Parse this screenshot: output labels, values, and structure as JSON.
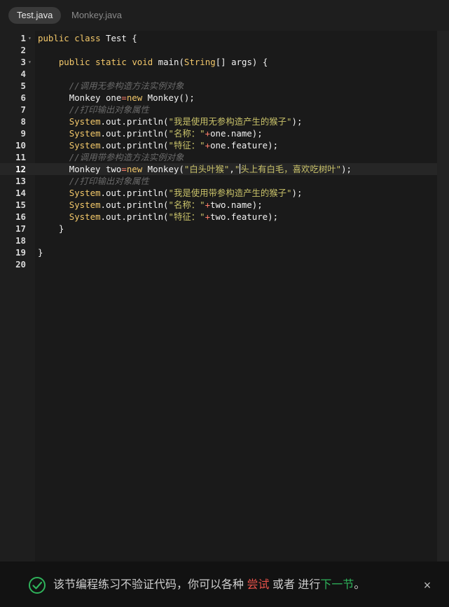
{
  "tabs": [
    {
      "label": "Test.java",
      "active": true
    },
    {
      "label": "Monkey.java",
      "active": false
    }
  ],
  "editor": {
    "current_line": 12,
    "lines": [
      {
        "n": "1",
        "fold": true,
        "tokens": [
          [
            "kw",
            "public"
          ],
          [
            "plain",
            " "
          ],
          [
            "kw",
            "class"
          ],
          [
            "plain",
            " Test {"
          ]
        ]
      },
      {
        "n": "2",
        "tokens": []
      },
      {
        "n": "3",
        "fold": true,
        "tokens": [
          [
            "plain",
            "    "
          ],
          [
            "kw",
            "public"
          ],
          [
            "plain",
            " "
          ],
          [
            "kw",
            "static"
          ],
          [
            "plain",
            " "
          ],
          [
            "kw",
            "void"
          ],
          [
            "plain",
            " main("
          ],
          [
            "cls",
            "String"
          ],
          [
            "plain",
            "[] args) {"
          ]
        ]
      },
      {
        "n": "4",
        "tokens": []
      },
      {
        "n": "5",
        "tokens": [
          [
            "plain",
            "      "
          ],
          [
            "cmt",
            "//调用无参构造方法实例对象"
          ]
        ]
      },
      {
        "n": "6",
        "tokens": [
          [
            "plain",
            "      Monkey one"
          ],
          [
            "op",
            "="
          ],
          [
            "kw",
            "new"
          ],
          [
            "plain",
            " Monkey();"
          ]
        ]
      },
      {
        "n": "7",
        "tokens": [
          [
            "plain",
            "      "
          ],
          [
            "cmt",
            "//打印输出对象属性"
          ]
        ]
      },
      {
        "n": "8",
        "tokens": [
          [
            "plain",
            "      "
          ],
          [
            "cls",
            "System"
          ],
          [
            "plain",
            ".out.println("
          ],
          [
            "str",
            "\"我是使用无参构造产生的猴子\""
          ],
          [
            "plain",
            ");"
          ]
        ]
      },
      {
        "n": "9",
        "tokens": [
          [
            "plain",
            "      "
          ],
          [
            "cls",
            "System"
          ],
          [
            "plain",
            ".out.println("
          ],
          [
            "str",
            "\"名称：\""
          ],
          [
            "op",
            "+"
          ],
          [
            "plain",
            "one.name);"
          ]
        ]
      },
      {
        "n": "10",
        "tokens": [
          [
            "plain",
            "      "
          ],
          [
            "cls",
            "System"
          ],
          [
            "plain",
            ".out.println("
          ],
          [
            "str",
            "\"特征：\""
          ],
          [
            "op",
            "+"
          ],
          [
            "plain",
            "one.feature);"
          ]
        ]
      },
      {
        "n": "11",
        "tokens": [
          [
            "plain",
            "      "
          ],
          [
            "cmt",
            "//调用带参构造方法实例对象"
          ]
        ]
      },
      {
        "n": "12",
        "tokens": [
          [
            "plain",
            "      Monkey two"
          ],
          [
            "op",
            "="
          ],
          [
            "kw",
            "new"
          ],
          [
            "plain",
            " Monkey("
          ],
          [
            "str",
            "\"白头叶猴\""
          ],
          [
            "plain",
            ","
          ],
          [
            "str",
            "\""
          ],
          [
            "cursor",
            ""
          ],
          [
            "str",
            "头上有白毛，喜欢吃树叶\""
          ],
          [
            "plain",
            ");"
          ]
        ]
      },
      {
        "n": "13",
        "tokens": [
          [
            "plain",
            "      "
          ],
          [
            "cmt",
            "//打印输出对象属性"
          ]
        ]
      },
      {
        "n": "14",
        "tokens": [
          [
            "plain",
            "      "
          ],
          [
            "cls",
            "System"
          ],
          [
            "plain",
            ".out.println("
          ],
          [
            "str",
            "\"我是使用带参构造产生的猴子\""
          ],
          [
            "plain",
            ");"
          ]
        ]
      },
      {
        "n": "15",
        "tokens": [
          [
            "plain",
            "      "
          ],
          [
            "cls",
            "System"
          ],
          [
            "plain",
            ".out.println("
          ],
          [
            "str",
            "\"名称：\""
          ],
          [
            "op",
            "+"
          ],
          [
            "plain",
            "two.name);"
          ]
        ]
      },
      {
        "n": "16",
        "tokens": [
          [
            "plain",
            "      "
          ],
          [
            "cls",
            "System"
          ],
          [
            "plain",
            ".out.println("
          ],
          [
            "str",
            "\"特征：\""
          ],
          [
            "op",
            "+"
          ],
          [
            "plain",
            "two.feature);"
          ]
        ]
      },
      {
        "n": "17",
        "tokens": [
          [
            "plain",
            "    }"
          ]
        ]
      },
      {
        "n": "18",
        "tokens": []
      },
      {
        "n": "19",
        "tokens": [
          [
            "plain",
            "}"
          ]
        ]
      },
      {
        "n": "20",
        "tokens": []
      }
    ]
  },
  "notice": {
    "text_before": "该节编程练习不验证代码，你可以各种",
    "try_link": "尝试",
    "text_middle": "或者 进行",
    "next_link": "下一节",
    "text_end": "。",
    "close_symbol": "×",
    "colors": {
      "check": "#2fb35b",
      "try": "#e8524a",
      "next": "#2fb35b"
    }
  }
}
